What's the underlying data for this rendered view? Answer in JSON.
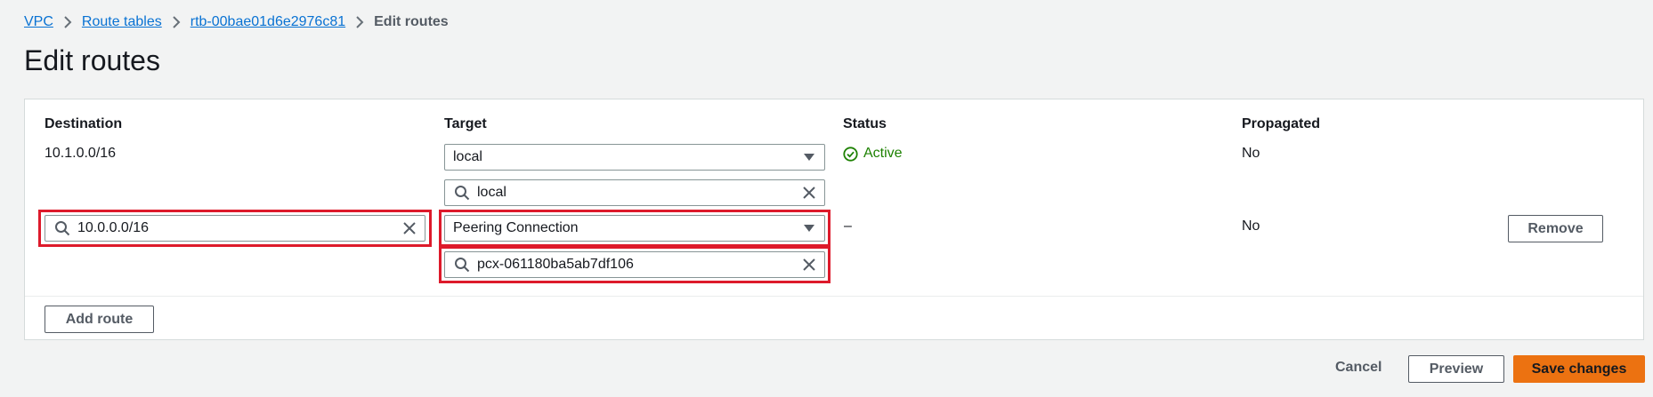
{
  "breadcrumb": {
    "items": [
      "VPC",
      "Route tables",
      "rtb-00bae01d6e2976c81"
    ],
    "current": "Edit routes"
  },
  "page": {
    "title": "Edit routes"
  },
  "table": {
    "headers": {
      "destination": "Destination",
      "target": "Target",
      "status": "Status",
      "propagated": "Propagated"
    },
    "rows": [
      {
        "destination": "10.1.0.0/16",
        "target_select": "local",
        "target_search": "local",
        "status": "Active",
        "propagated": "No"
      },
      {
        "destination_input": "10.0.0.0/16",
        "target_select": "Peering Connection",
        "target_search": "pcx-061180ba5ab7df106",
        "status": "–",
        "propagated": "No",
        "remove_label": "Remove"
      }
    ],
    "add_route_label": "Add route"
  },
  "footer": {
    "cancel_label": "Cancel",
    "preview_label": "Preview",
    "save_label": "Save changes"
  },
  "colors": {
    "link": "#0972d3",
    "success": "#1d8102",
    "primary": "#ec7211",
    "highlight": "#dd1a2b"
  },
  "icons": [
    "chevron-right-icon",
    "search-icon",
    "clear-icon",
    "caret-down-icon",
    "check-circle-icon"
  ]
}
